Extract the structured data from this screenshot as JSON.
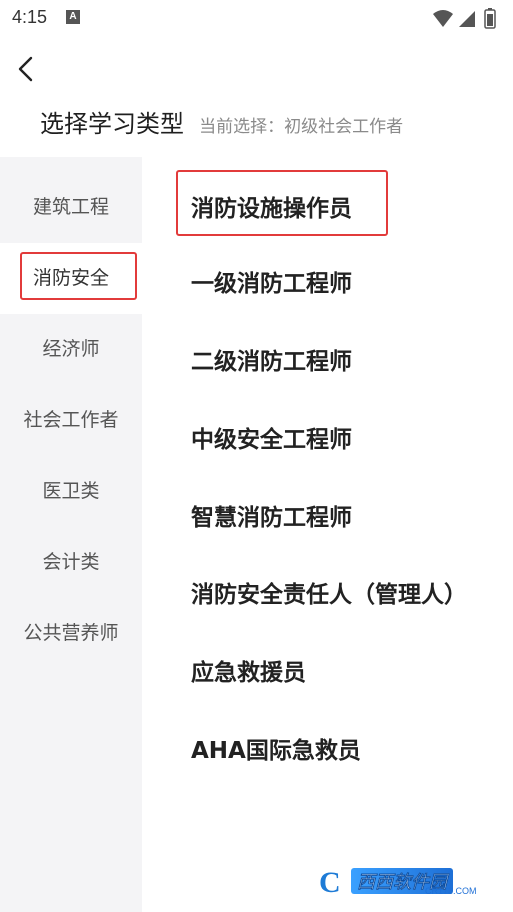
{
  "status_bar": {
    "time": "4:15",
    "notification_letter": "A"
  },
  "header": {
    "title": "选择学习类型",
    "current_selection": "当前选择：初级社会工作者"
  },
  "sidebar": {
    "items": [
      {
        "label": "建筑工程"
      },
      {
        "label": "消防安全",
        "active": true
      },
      {
        "label": "经济师"
      },
      {
        "label": "社会工作者"
      },
      {
        "label": "医卫类"
      },
      {
        "label": "会计类"
      },
      {
        "label": "公共营养师"
      }
    ]
  },
  "content": {
    "items": [
      {
        "label": "消防设施操作员",
        "highlighted": true
      },
      {
        "label": "一级消防工程师"
      },
      {
        "label": "二级消防工程师"
      },
      {
        "label": "中级安全工程师"
      },
      {
        "label": "智慧消防工程师"
      },
      {
        "label": "消防安全责任人（管理人）"
      },
      {
        "label": "应急救援员"
      },
      {
        "label": "AHA国际急救员"
      }
    ]
  },
  "watermark": {
    "logo_letter": "C",
    "title": "西西软件园",
    "site": "CR173.COM"
  },
  "colors": {
    "highlight": "#e23b3b",
    "sidebar_bg": "#f4f4f6"
  }
}
